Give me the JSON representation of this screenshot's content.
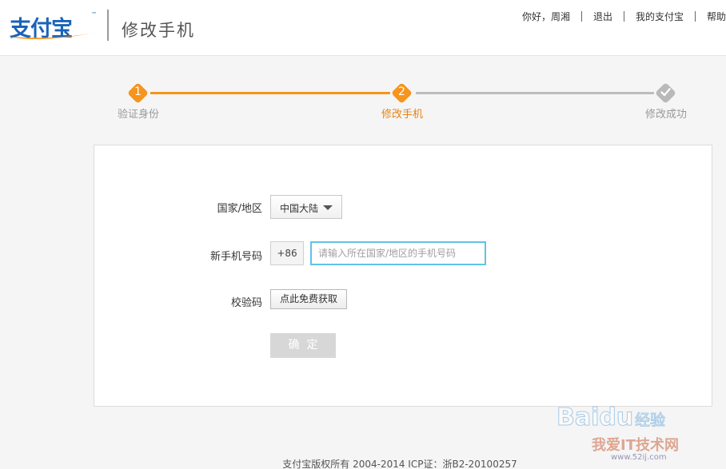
{
  "brand": {
    "logo_text": "支付宝",
    "logo_tm": "™",
    "page_heading": "修改手机"
  },
  "top_nav": {
    "greeting": "你好，周湘",
    "logout": "退出",
    "my_alipay": "我的支付宝",
    "help": "帮助"
  },
  "steps": [
    {
      "number": "1",
      "label": "验证身份",
      "state": "done"
    },
    {
      "number": "2",
      "label": "修改手机",
      "state": "current"
    },
    {
      "number": "",
      "label": "修改成功",
      "state": "todo"
    }
  ],
  "form": {
    "country_label": "国家/地区",
    "country_value": "中国大陆",
    "phone_label": "新手机号码",
    "area_code": "+86",
    "phone_placeholder": "请输入所在国家/地区的手机号码",
    "code_label": "校验码",
    "sms_button": "点此免费获取",
    "confirm_button": "确定"
  },
  "footer": {
    "copyright": "支付宝版权所有 2004-2014 ICP证：浙B2-20100257"
  },
  "watermark": {
    "baidu": "Baidu",
    "jingyan": "经验",
    "site": "我爱IT技术网",
    "url": "www.52ij.com"
  },
  "colors": {
    "brand_blue": "#1b63b8",
    "step_orange": "#f7941d",
    "step_gray": "#bdbdbd",
    "input_focus": "#5fc3e8",
    "button_disabled": "#d7d7d7"
  }
}
